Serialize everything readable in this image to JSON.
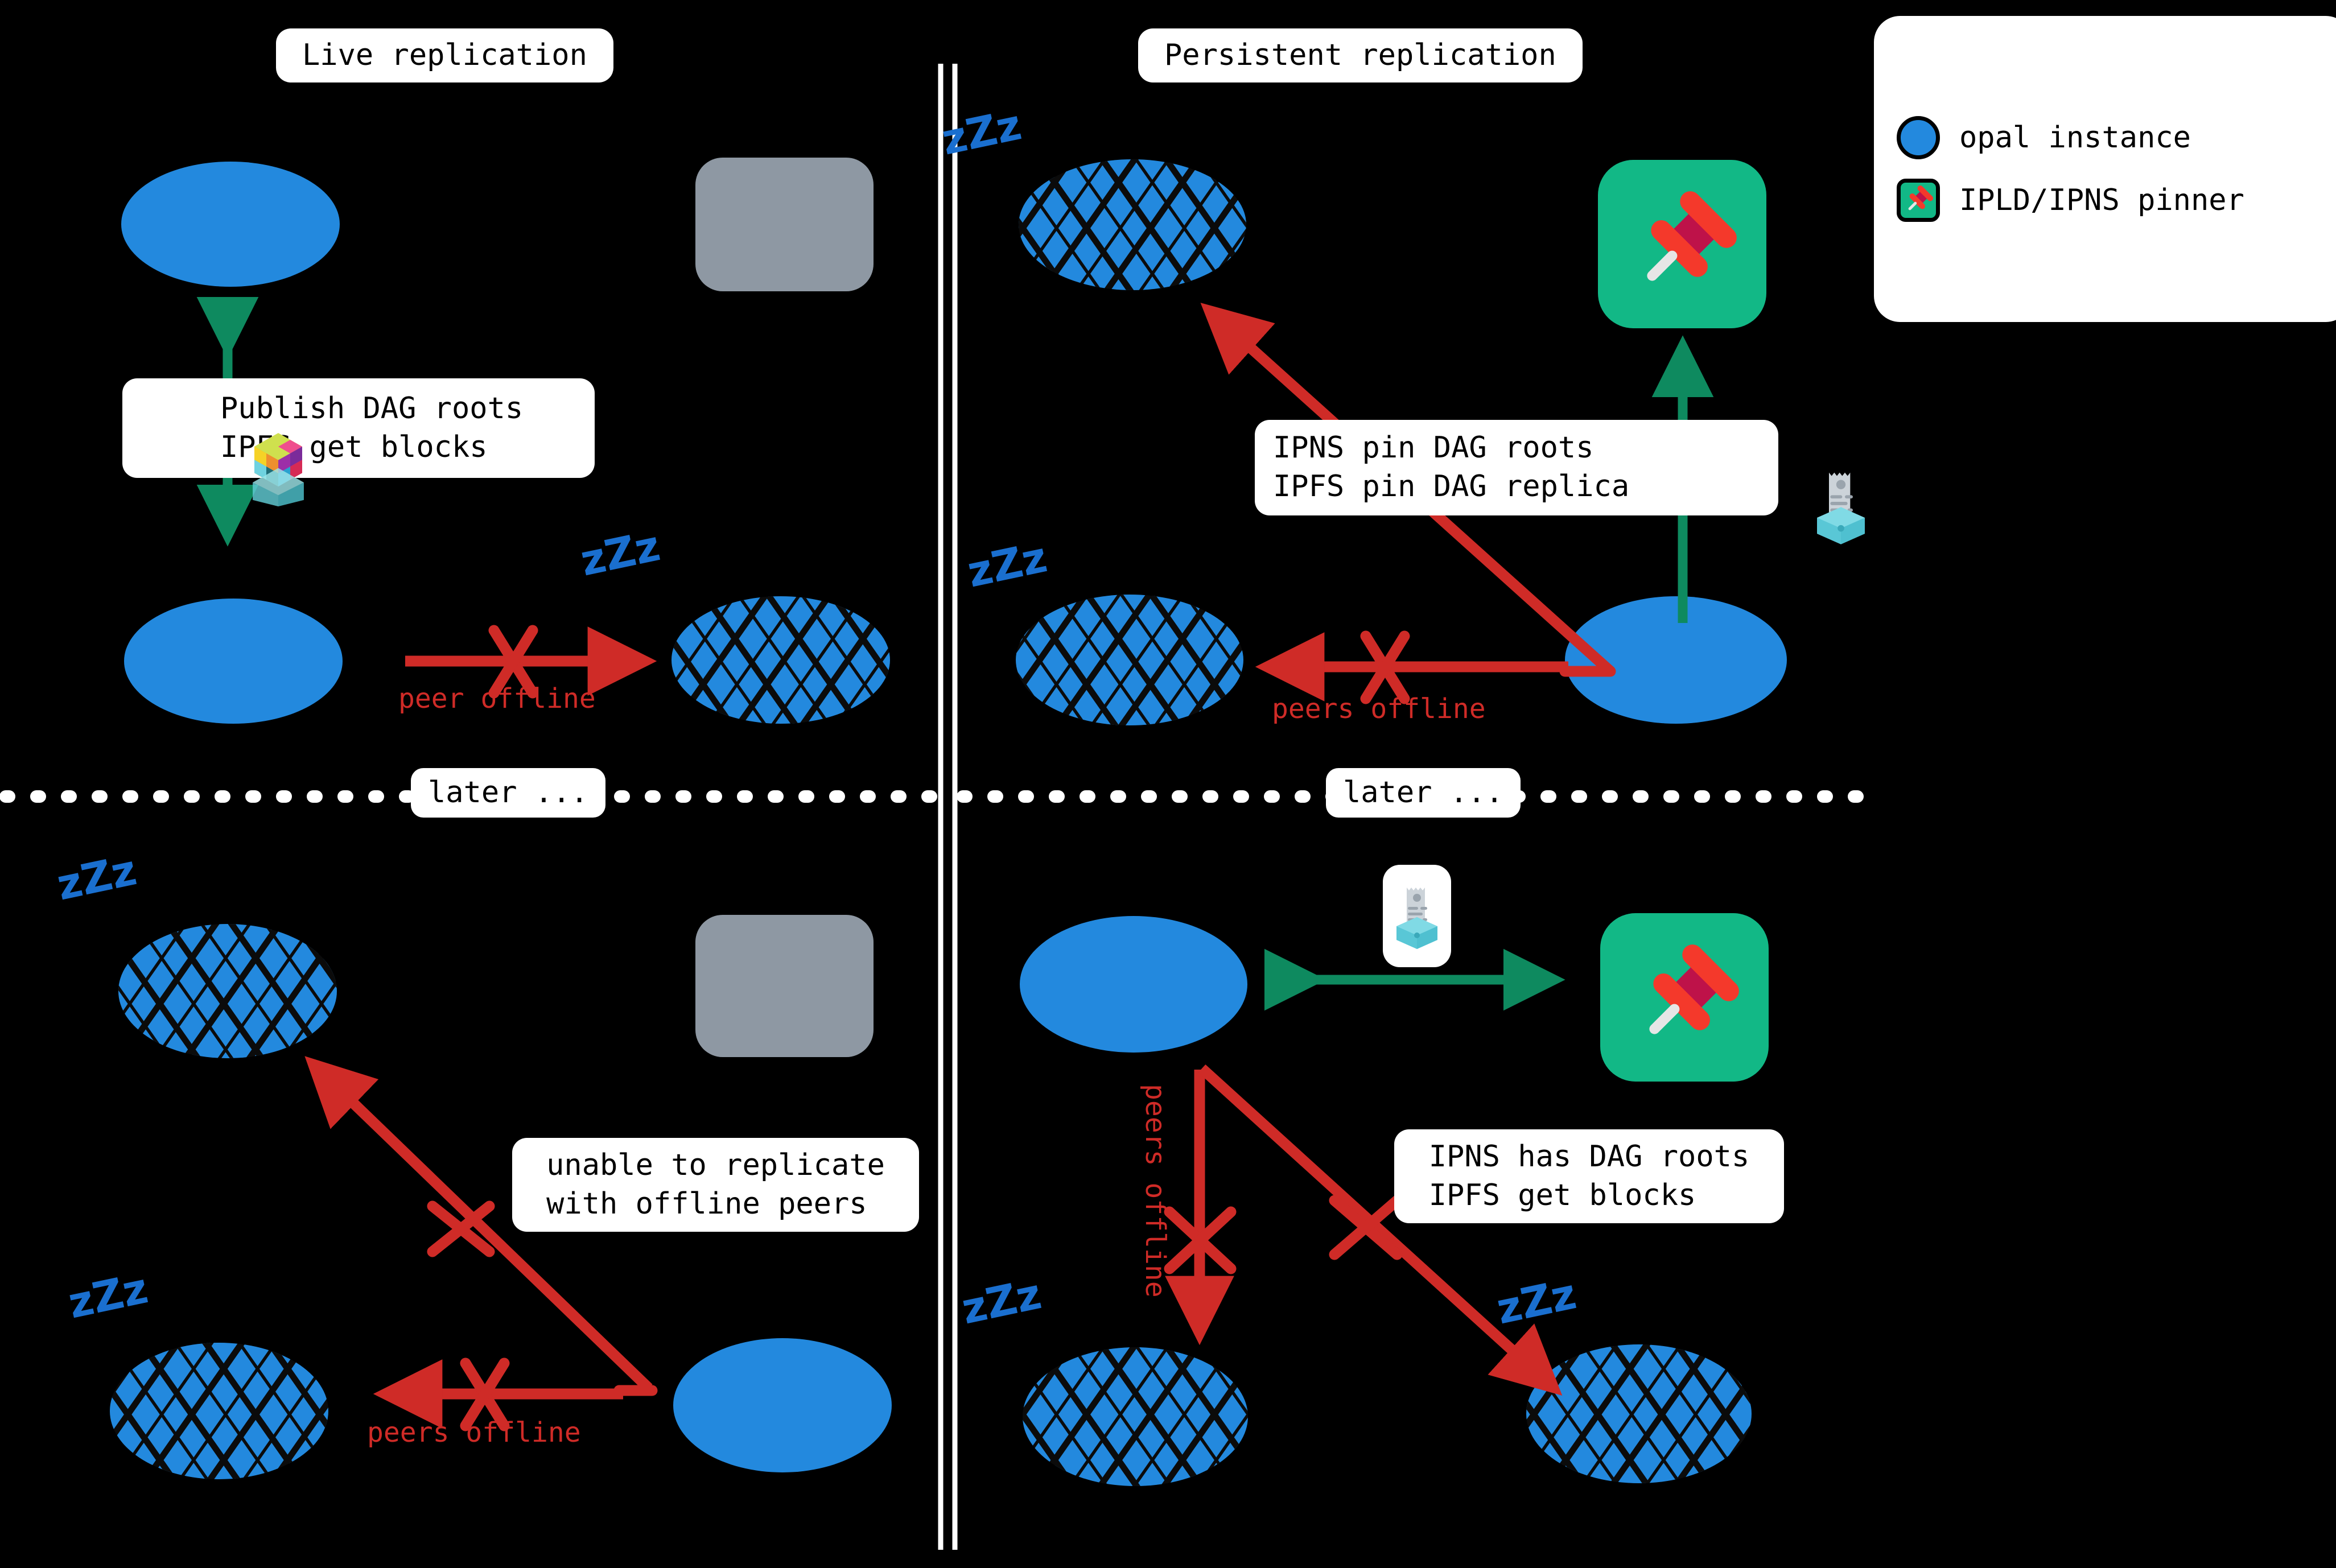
{
  "diagram": {
    "background_color": "#000000",
    "title_left": "Live replication",
    "title_right": "Persistent replication",
    "divider_label_left": "later ...",
    "divider_label_right": "later ..."
  },
  "colors": {
    "node_blue": "#2389DE",
    "offline_hatch": "#000000",
    "grey_box": "#8E98A3",
    "arrow_red": "#CF2B27",
    "arrow_green": "#0E8A5F",
    "pinner_green": "#12B886",
    "pin_red": "#F4392B",
    "pin_dark_red": "#BE1249",
    "zzz_blue": "#1A6FCF",
    "panel_white": "#FFFFFF"
  },
  "legend": {
    "items": [
      {
        "icon": "blue-circle-icon",
        "label": "opal instance"
      },
      {
        "icon": "pushpin-icon",
        "label": "IPLD/IPNS pinner"
      }
    ]
  },
  "panels": {
    "top_left": {
      "name": "Live replication",
      "note": {
        "icon": "ipld-cube-icon",
        "lines": [
          "Publish DAG roots",
          "IPFS get blocks"
        ]
      },
      "edge_label": "peer offline",
      "nodes": [
        {
          "state": "online",
          "shape": "ellipse"
        },
        {
          "state": "placeholder",
          "shape": "rounded-rect"
        },
        {
          "state": "online",
          "shape": "ellipse"
        },
        {
          "state": "offline",
          "shape": "ellipse",
          "sleep": "zZz"
        }
      ]
    },
    "top_right": {
      "name": "Persistent replication",
      "note": {
        "icon": "ipns-receipt-cube-icon",
        "lines": [
          "IPNS pin DAG roots",
          "IPFS pin DAG replica"
        ]
      },
      "edge_label": "peers offline",
      "nodes": [
        {
          "state": "offline",
          "shape": "ellipse",
          "sleep": "zZz"
        },
        {
          "state": "pinner",
          "shape": "rounded-rect"
        },
        {
          "state": "offline",
          "shape": "ellipse",
          "sleep": "zZz"
        },
        {
          "state": "online",
          "shape": "ellipse"
        }
      ]
    },
    "bottom_left": {
      "note": {
        "lines": [
          "unable to replicate",
          "with offline peers"
        ]
      },
      "edge_label": "peers offline",
      "nodes": [
        {
          "state": "offline",
          "shape": "ellipse",
          "sleep": "zZz"
        },
        {
          "state": "placeholder",
          "shape": "rounded-rect"
        },
        {
          "state": "offline",
          "shape": "ellipse",
          "sleep": "zZz"
        },
        {
          "state": "online",
          "shape": "ellipse"
        }
      ]
    },
    "bottom_right": {
      "note": {
        "lines": [
          "IPNS has DAG roots",
          "IPFS get blocks"
        ]
      },
      "edge_label_vertical": "peers offline",
      "icon": "ipns-receipt-cube-icon",
      "nodes": [
        {
          "state": "online",
          "shape": "ellipse"
        },
        {
          "state": "pinner",
          "shape": "rounded-rect"
        },
        {
          "state": "offline",
          "shape": "ellipse",
          "sleep": "zZz"
        },
        {
          "state": "offline",
          "shape": "ellipse",
          "sleep": "zZz"
        }
      ]
    }
  },
  "sleep_marks": {
    "text": "zZz"
  }
}
